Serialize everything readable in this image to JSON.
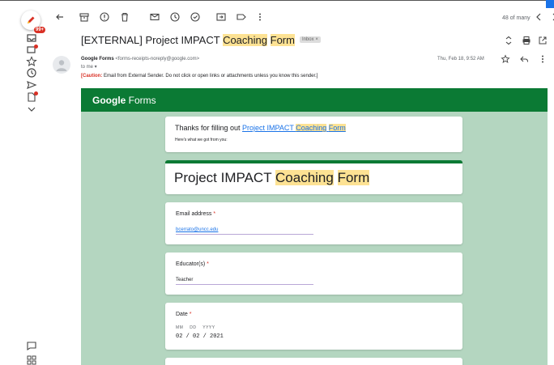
{
  "rail": {
    "inbox_badge": "99+"
  },
  "toolbar": {
    "count": "48 of many"
  },
  "email": {
    "subject_prefix": "[EXTERNAL] Project IMPACT ",
    "subject_hl1": "Coaching",
    "subject_hl2": "Form",
    "inbox_chip": "Inbox ×",
    "sender_name": "Google Forms",
    "sender_addr": "<forms-receipts-noreply@google.com>",
    "to": "to me ▾",
    "date": "Thu, Feb 18, 9:52 AM",
    "caution_label": "[Caution:",
    "caution_text": " Email from External Sender. Do not click or open links or attachments unless you know this sender.]"
  },
  "forms": {
    "logo_bold": "Google",
    "logo_rest": " Forms",
    "thanks_prefix": "Thanks for filling out ",
    "link_prefix": "Project IMPACT ",
    "link_hl1": "Coaching",
    "link_hl2": "Form",
    "heres": "Here's what we got from you:",
    "title_prefix": "Project IMPACT ",
    "title_hl1": "Coaching",
    "title_hl2": "Form",
    "q_email": "Email address",
    "a_email": "bcerrato@uncc.edu",
    "q_educator": "Educator(s)",
    "a_educator": "Teacher",
    "q_date": "Date",
    "date_hint": "MM DD YYYY",
    "a_date": "02 / 02 / 2021",
    "req_mark": "*"
  },
  "colors": {
    "forms_green": "#0b7a34",
    "forms_bg": "#b4d6c0",
    "highlight": "#fde293",
    "link": "#1a73e8",
    "required": "#d93025"
  }
}
